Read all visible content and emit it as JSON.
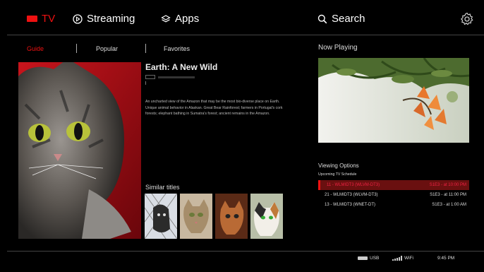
{
  "nav": {
    "tv_label": "TV",
    "streaming_label": "Streaming",
    "apps_label": "Apps",
    "search_label": "Search",
    "icons": [
      "tv-icon",
      "play-circle-icon",
      "layers-icon",
      "search-icon",
      "gear-icon"
    ]
  },
  "subnav": {
    "guide": "Guide",
    "popular": "Popular",
    "favorites": "Favorites",
    "active": "Guide"
  },
  "program": {
    "title": "Earth: A New Wild",
    "description": "An uncharted view of the Amazon that may be the most bio-diverse place on Earth. Unique animal behavior in Alaskan. Great Bear Rainforest; farmers in Portugal's cork forests; elephant bathing in Sumatra's forest; ancient remains in the Amazon."
  },
  "similar": {
    "title": "Similar titles"
  },
  "now_playing": {
    "title": "Now Playing"
  },
  "viewing_options": {
    "title": "Viewing Options",
    "subtitle": "Upcoming TV Schedule",
    "rows": [
      {
        "channel": "11 - WLMIDT3 (WLVM-DT3)",
        "time": "S1E3 - at 10:00 PM"
      },
      {
        "channel": "21 - WLMIDT3 (WLVM-DT3)",
        "time": "S1E3 - at 11:00 PM"
      },
      {
        "channel": "13 - WLMIDT3 (WNET-DT)",
        "time": "S1E3 - at 1:00 AM"
      }
    ],
    "active_row": 0
  },
  "status": {
    "usb": "USB",
    "wifi": "WiFi",
    "time": "9:45 PM"
  },
  "colors": {
    "accent": "#e11111",
    "background": "#000000"
  }
}
